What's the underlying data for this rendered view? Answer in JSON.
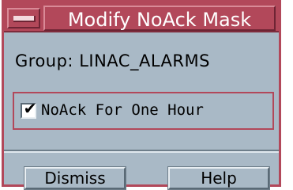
{
  "window": {
    "title": "Modify NoAck Mask"
  },
  "group": {
    "label": "Group:",
    "value": "LINAC_ALARMS"
  },
  "noack": {
    "label": "NoAck For One Hour",
    "checked": true,
    "check_glyph": "✔"
  },
  "buttons": {
    "dismiss": "Dismiss",
    "help": "Help"
  },
  "colors": {
    "title_bar": "#b2485a",
    "background": "#a9b9c6"
  }
}
